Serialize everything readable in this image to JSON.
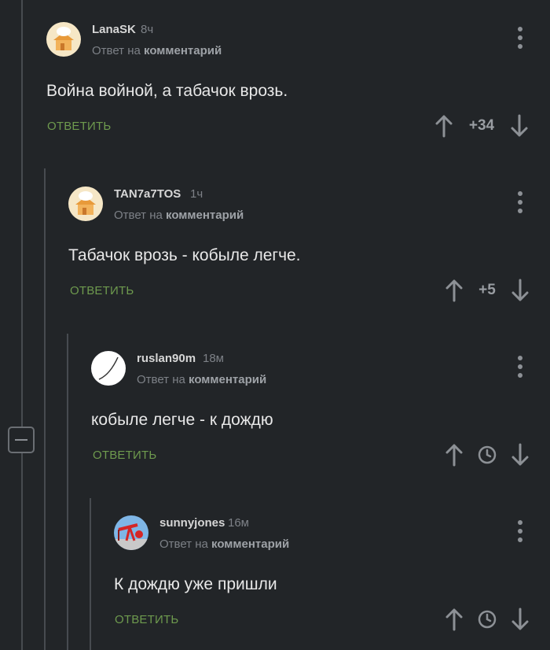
{
  "thread": {
    "reply_prefix": "Ответ на",
    "reply_target": "комментарий",
    "reply_label": "ОТВЕТИТЬ"
  },
  "comments": [
    {
      "author": "LanaSK",
      "time": "8ч",
      "text": "Война войной, а табачок врозь.",
      "score": "+34",
      "avatar_icon": "chef-house-avatar-icon"
    },
    {
      "author": "TAN7a7TOS",
      "time": "1ч",
      "text": "Табачок врозь - кобыле легче.",
      "score": "+5",
      "avatar_icon": "chef-house-avatar-icon"
    },
    {
      "author": "ruslan90m",
      "time": "18м",
      "text": "кобыле легче - к  дождю",
      "score": "",
      "avatar_icon": "curve-line-avatar-icon"
    },
    {
      "author": "sunnyjones",
      "time": "16м",
      "text": "К дождю уже пришли",
      "score": "",
      "avatar_icon": "oil-pump-avatar-icon"
    }
  ],
  "colors": {
    "background": "#222528",
    "reply_link": "#6e9a4e",
    "thread_line": "#474b50"
  }
}
